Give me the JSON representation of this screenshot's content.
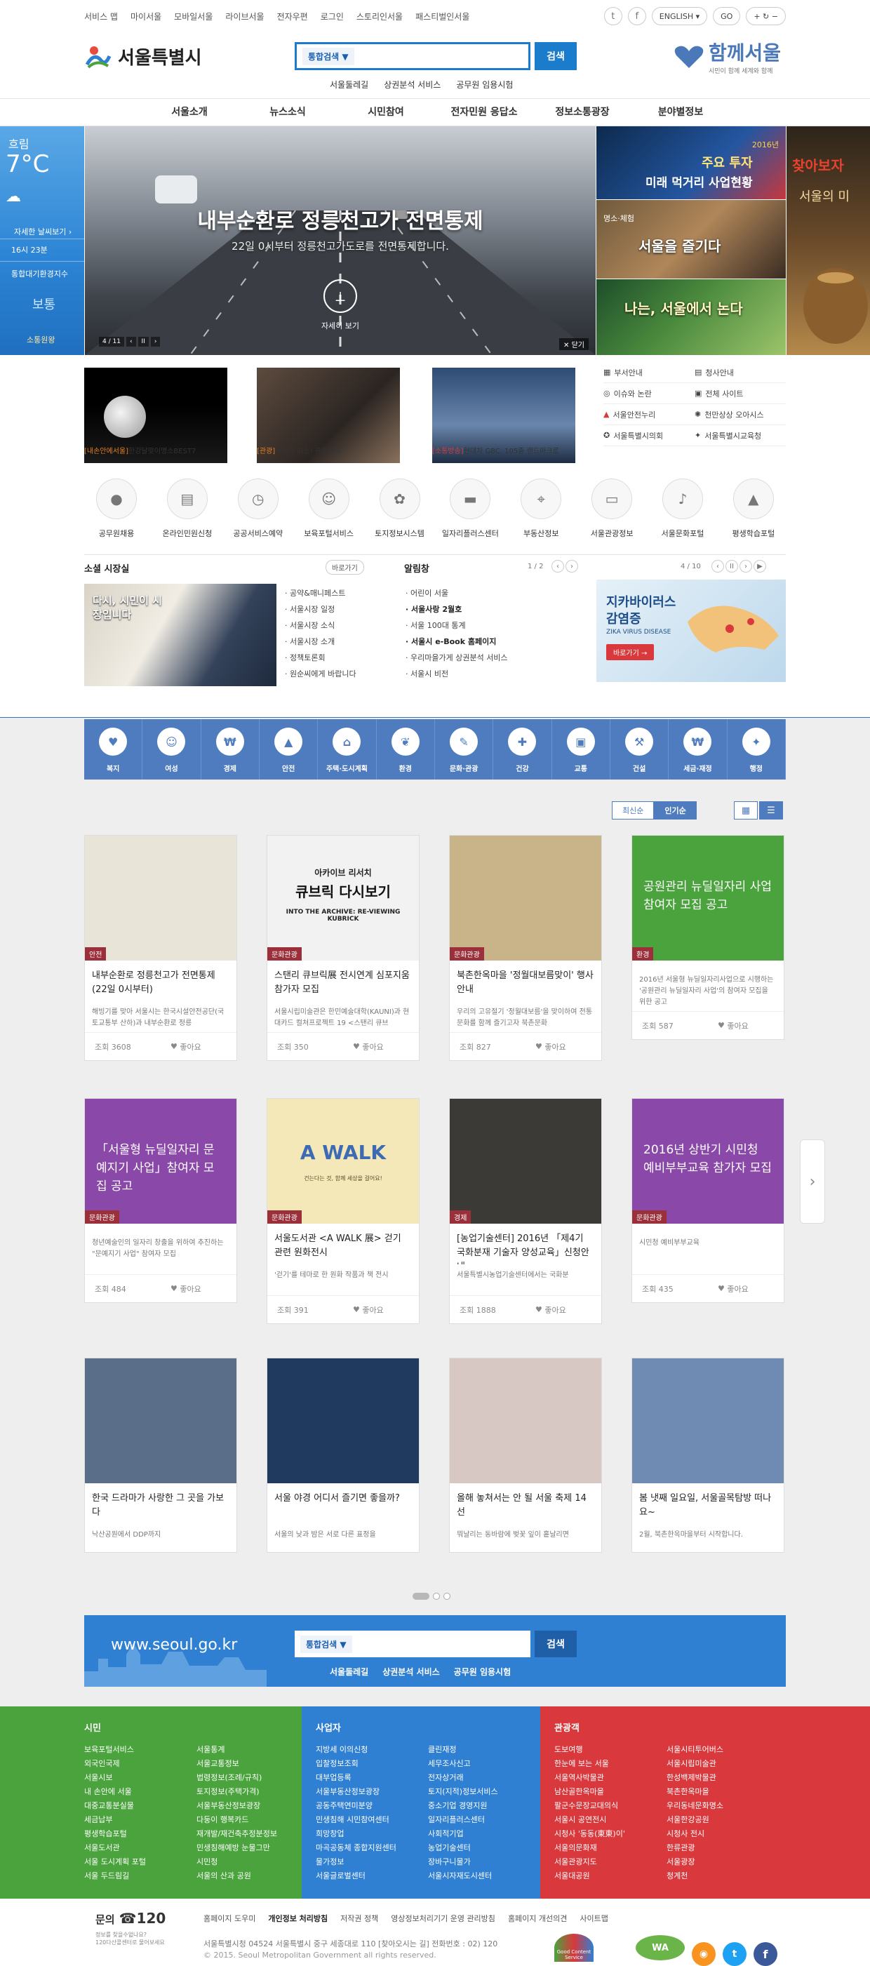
{
  "utility_links": [
    "서비스 맵",
    "마이서울",
    "모바일서울",
    "라이브서울",
    "전자우편",
    "로그인",
    "스토리인서울",
    "패스티벌인서울"
  ],
  "language": {
    "selected": "ENGLISH",
    "go": "GO"
  },
  "logo": {
    "title": "서울특별시"
  },
  "search": {
    "scope": "통합검색 ▼",
    "button": "검색",
    "quick_links": [
      "서울둘레길",
      "상권분석 서비스",
      "공무원 임용시험"
    ]
  },
  "together": {
    "title": "함께서울",
    "subtitle": "시민이 함께 세계와 함께"
  },
  "gnb": [
    "서울소개",
    "뉴스소식",
    "시민참여",
    "전자민원 응답소",
    "정보소통광장",
    "분야별정보"
  ],
  "weather": {
    "sky": "흐림",
    "temp": "7°C",
    "detail_link": "자세한 날씨보기 ›",
    "time": "16시 23분",
    "air_label": "통합대기환경지수",
    "air_value": "보통",
    "footer": "소통원왕"
  },
  "hero": {
    "title": "내부순환로 정릉천고가 전면통제",
    "subtitle": "22일 0시부터 정릉천고가도로를 전면통제합니다.",
    "action": "자세히 보기",
    "counter": "4 / 11",
    "close": "닫기"
  },
  "promos": {
    "a": {
      "year": "2016년",
      "line1": "주요 투자",
      "line2": "미래 먹거리 사업현황"
    },
    "b": {
      "tag": "명소·체험",
      "title": "서울을 즐기다"
    },
    "c": {
      "title": "나는, 서울에서 논다"
    },
    "d": {
      "title": "찾아보자",
      "sub": "서울의 미"
    }
  },
  "thumbs": [
    {
      "tag": "[내손안에서울]",
      "text": "한강달맞이명소BEST7",
      "color": "#e67e22"
    },
    {
      "tag": "[관광]",
      "text": "서울의 미소! 관광안내",
      "color": "#e67e22"
    },
    {
      "tag": "[소통방송]",
      "text": "현대차 GBC, 105층 랜드마크로",
      "color": "#d9383c"
    }
  ],
  "quick_links": [
    [
      "부서안내",
      "청사안내"
    ],
    [
      "이슈와 논란",
      "전체 사이트"
    ],
    [
      "서울안전누리",
      "천만상상 오아시스"
    ],
    [
      "서울특별시의회",
      "서울특별시교육청"
    ]
  ],
  "services": [
    "공무원채용",
    "온라인민원신청",
    "공공서비스예약",
    "보육포털서비스",
    "토지정보시스템",
    "일자리플러스센터",
    "부동산정보",
    "서울관광정보",
    "서울문화포털",
    "평생학습포털"
  ],
  "mayor": {
    "title": "소셜 시장실",
    "more": "바로가기",
    "img_caption": "다시, 시민이 시장입니다",
    "items": [
      "공약&매니페스트",
      "서울시장 일정",
      "서울시장 소식",
      "서울시장 소개",
      "정책토론회",
      "원순씨에게 바랍니다"
    ]
  },
  "notice": {
    "title": "알림창",
    "page": "1 / 2",
    "items": [
      "어린이 서울",
      "서울사랑 2월호",
      "서울 100대 통계",
      "서울시 e-Book 홈페이지",
      "우리마을가게 상권분석 서비스",
      "서울시 비전"
    ]
  },
  "banner": {
    "page": "4 / 10",
    "title": "지카바이러스",
    "title2": "감염증",
    "en": "ZIKA VIRUS DISEASE",
    "button": "바로가기 →"
  },
  "categories": [
    "복지",
    "여성",
    "경제",
    "안전",
    "주택·도시계획",
    "환경",
    "문화·관광",
    "건강",
    "교통",
    "건설",
    "세금·재정",
    "행정"
  ],
  "sort": {
    "latest": "최신순",
    "popular": "인기순"
  },
  "cards": [
    {
      "tag": "안전",
      "title": "내부순환로 정릉천고가 전면통제(22일 0시부터)",
      "desc": "해빙기를 맞아 서울시는 한국시설안전공단(국토교통부 산하)과 내부순환로 정릉",
      "views": "조회 3608",
      "like": "좋아요",
      "bg": "#e8e4d8"
    },
    {
      "tag": "문화관광",
      "title": "스탠리 큐브릭展 전시연계 심포지움 참가자 모집",
      "desc": "서울시립미술관은 한민예술대학(KAUNI)과 현대카드 컬처프로젝트 19 <스탠리 큐브",
      "views": "조회 350",
      "like": "좋아요",
      "bg": "#f2f2f2",
      "banner_title": "아카이브 리서치",
      "banner_big": "큐브릭 다시보기",
      "banner_en": "INTO THE ARCHIVE: RE-VIEWING KUBRICK"
    },
    {
      "tag": "문화관광",
      "title": "북촌한옥마을 '정월대보름맞이' 행사 안내",
      "desc": "우리의 고유절기 '정월대보름'을 맞이하여 전통문화를 함께 즐기고자 북촌문화",
      "views": "조회 827",
      "like": "좋아요",
      "bg": "#c9b48a"
    },
    {
      "tag": "환경",
      "title": "",
      "desc": "2016년 서울형 뉴딜일자리사업으로 시행하는 '공원관리 뉴딜일자리 사업'의 참여자 모집을 위한 공고",
      "views": "조회 587",
      "like": "좋아요",
      "bg": "#4aa33d",
      "panel": "공원관리 뉴딜일자리 사업 참여자 모집 공고"
    },
    {
      "tag": "문화관광",
      "title": "",
      "desc": "청년예술인의 일자리 창출을 위하여 추진하는 \"문예지기 사업\" 참여자 모집",
      "views": "조회 484",
      "like": "좋아요",
      "bg": "#8a48a8",
      "panel": "「서울형 뉴딜일자리 문예지기 사업」참여자 모집 공고"
    },
    {
      "tag": "문화관광",
      "title": "서울도서관 <A WALK 展> 걷기 관련 원화전시",
      "desc": "'걷기'를 테마로 한 원화 작품과 책 전시",
      "views": "조회 391",
      "like": "좋아요",
      "bg": "#f4e7b8",
      "banner_big": "A WALK",
      "banner_sub": "건는다는 것, 함께 세상을 걸어요!"
    },
    {
      "tag": "경제",
      "title": "[농업기술센터] 2016년 「제4기 국화분재 기술자 양성교육」신청안내",
      "desc": "서울특별시농업기술센터에서는 국화분",
      "views": "조회 1888",
      "like": "좋아요",
      "bg": "#3b3a36"
    },
    {
      "tag": "문화관광",
      "title": "",
      "desc": "시민청 예비부부교육",
      "views": "조회 435",
      "like": "좋아요",
      "bg": "#8a48a8",
      "panel": "2016년 상반기 시민청 예비부부교육 참가자 모집"
    },
    {
      "tag": "",
      "title": "한국 드라마가 사랑한 그 곳을 가보다",
      "desc": "낙산공원에서 DDP까지",
      "views": "",
      "like": "",
      "bg": "#5a6e8a"
    },
    {
      "tag": "",
      "title": "서울 야경 어디서 즐기면 좋을까?",
      "desc": "서울의 낮과 밤은 서로 다른 표정을",
      "views": "",
      "like": "",
      "bg": "#1f3a5e"
    },
    {
      "tag": "",
      "title": "올해 놓쳐서는 안 될 서울 축제 14선",
      "desc": "뭐날리는 동바람에 벚꽃 잎이 흩날리면",
      "views": "",
      "like": "",
      "bg": "#d8c8c4"
    },
    {
      "tag": "",
      "title": "봄 냇째 일요일, 서울골목탐방 떠나요~",
      "desc": "2월, 북촌한옥마을부터 시작합니다.",
      "views": "",
      "like": "",
      "bg": "#6f8bb3"
    }
  ],
  "bottom_search": {
    "site": "www.seoul.go.kr",
    "scope": "통합검색 ▼",
    "button": "검색",
    "links": [
      "서울둘레길",
      "상권분석 서비스",
      "공무원 임용시험"
    ]
  },
  "sitemap": [
    {
      "title": "시민",
      "color": "#4aa33d",
      "items": [
        "보육포털서비스",
        "서울통계",
        "외국인국제",
        "서울교통정보",
        "서울시보",
        "법령정보(조례/규칙)",
        "내 손안에 서울",
        "토지정보(주택가격)",
        "대중교통분실물",
        "서울부동산정보광장",
        "세금납부",
        "다둥이 행복카드",
        "평생학습포털",
        "재개발/재건축추정분정보",
        "서울도서관",
        "민생침해예방 눈물그만",
        "서울 도시계획 포털",
        "시민청",
        "서울 두드림길",
        "서울의 산과 공원"
      ]
    },
    {
      "title": "사업자",
      "color": "#2f7fd2",
      "items": [
        "지방세 이의신청",
        "클린재정",
        "입찰정보조회",
        "세무조사신고",
        "대부업등록",
        "전자상거래",
        "서울부동산정보광장",
        "토지(지적)정보서비스",
        "공동주택연미분양",
        "중소기업 경영지원",
        "민생침해 시민참여센터",
        "일자리플러스센터",
        "희망창업",
        "사회적기업",
        "마곡공동체 종합지원센터",
        "농업기술센터",
        "물가정보",
        "장바구니물가",
        "서울글로벌센터",
        "서울시자재도시센터"
      ]
    },
    {
      "title": "관광객",
      "color": "#d9383c",
      "items": [
        "도보여행",
        "서울시티투어버스",
        "한눈에 보는 서울",
        "서울시립미술관",
        "서울역사박물관",
        "한성백제박물관",
        "남산골한옥마을",
        "북촌한옥마을",
        "팔군수문장교대의식",
        "우리동네문화명소",
        "서울시 공연전시",
        "서울한강공원",
        "시청사 '동동(東東)이'",
        "시청사 전시",
        "서울의문화재",
        "한류관광",
        "서울관광지도",
        "서울광장",
        "서울대공원",
        "청계천"
      ]
    }
  ],
  "footer": {
    "contact_label": "문의",
    "phone": "☎120",
    "contact_sub1": "정보를 찾을수없나요?",
    "contact_sub2": "120다산콜센터로 물어보세요",
    "links": [
      "홈페이지 도우미",
      "개인정보 처리방침",
      "저작권 정책",
      "영상정보처리기기 운영 관리방침",
      "홈페이지 개선의견",
      "사이트맵"
    ],
    "address": "서울특별시청 04524 서울특별시 중구 세종대로 110 [찾아오시는 길] 전화번호 : 02) 120",
    "copyright": "© 2015. Seoul Metropolitan Government all rights reserved.",
    "badge1": "Good Content Service",
    "badge2": "WA"
  },
  "colors": {
    "brand": "#1a7ccb",
    "category": "#4f7bbf",
    "citizen": "#4aa33d",
    "business": "#2f7fd2",
    "tourist": "#d9383c"
  }
}
